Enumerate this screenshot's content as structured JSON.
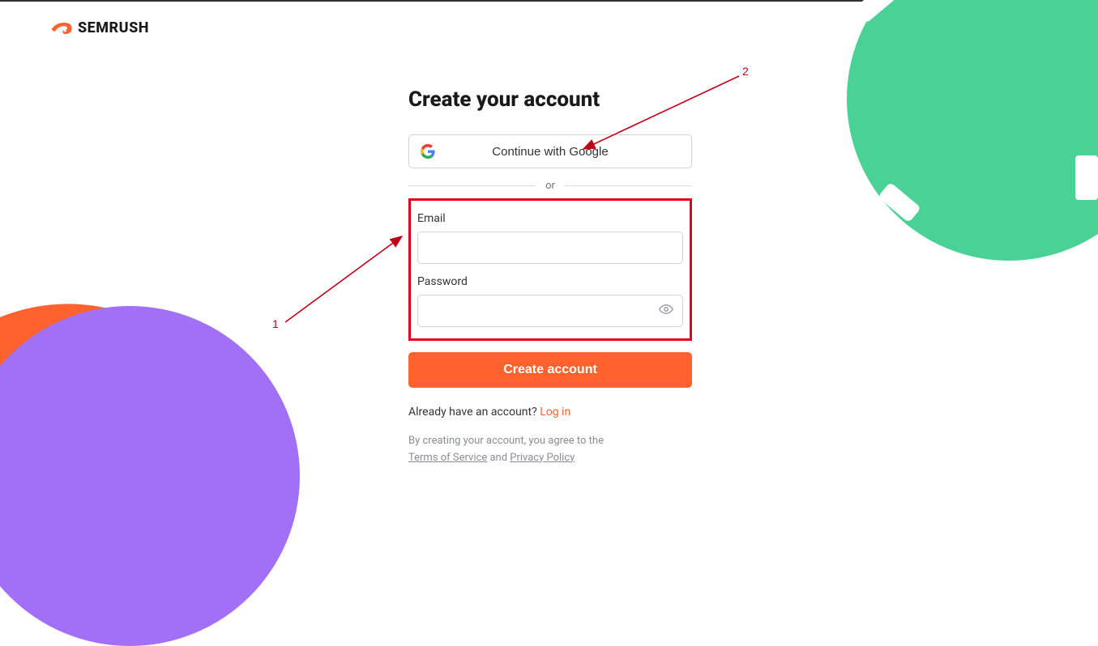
{
  "brand": {
    "name": "SEMRUSH"
  },
  "page": {
    "heading": "Create your account",
    "google_button": "Continue with Google",
    "divider": "or"
  },
  "form": {
    "email_label": "Email",
    "email_value": "",
    "password_label": "Password",
    "password_value": ""
  },
  "actions": {
    "create_button": "Create account"
  },
  "login_prompt": {
    "text": "Already have an account? ",
    "link": "Log in"
  },
  "legal": {
    "prefix": "By creating your account, you agree to the ",
    "tos": "Terms of Service",
    "and": " and ",
    "privacy": "Privacy Policy"
  },
  "annotations": {
    "label1": "1",
    "label2": "2"
  },
  "colors": {
    "primary": "#ff622d",
    "green": "#4ad196",
    "purple": "#a170f6",
    "highlight_red": "#e2001a"
  }
}
